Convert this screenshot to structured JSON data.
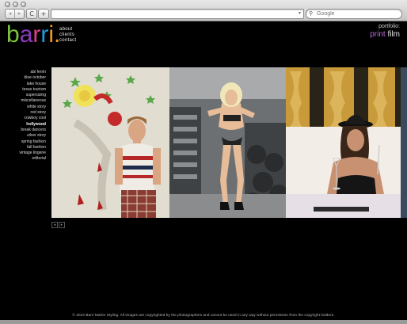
{
  "browser": {
    "nav_back": "◂",
    "nav_forward": "▸",
    "reload": "C",
    "add": "+",
    "address_value": "",
    "search_placeholder": "Google"
  },
  "site": {
    "logo_letters": [
      "b",
      "a",
      "r",
      "r",
      "i"
    ],
    "logo_dot": ".",
    "top_nav": [
      "about",
      "clients",
      "contact"
    ],
    "portfolio_label": "portfolio:",
    "portfolio_print": "print",
    "portfolio_film": "film",
    "side_nav": [
      "abi ferrin",
      "blue october",
      "lake house",
      "texas tourism",
      "supersizing",
      "miscellaneous",
      "white story",
      "red story",
      "cowboy cool",
      "hollywood",
      "break dancers",
      "silver story",
      "spring fashion",
      "fall fashion",
      "vintage lingerie",
      "editorial"
    ],
    "active_item": "hollywood",
    "pager_prev": "◂",
    "pager_next": "▸",
    "footer": "© 2010 Barri Martin Styling. All images are copyrighted by the photographers and cannot be used in any way without permission from the copyright holders."
  },
  "colors": {
    "logo": [
      "#7ec23d",
      "#8a3bbf",
      "#e23b8a",
      "#1e9ee0",
      "#f29b1d"
    ],
    "print_accent": "#b96ad9"
  }
}
